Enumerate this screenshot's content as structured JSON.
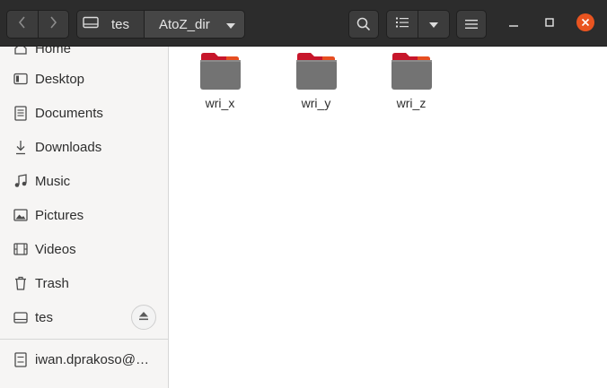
{
  "window": {
    "path": {
      "home_label": "tes",
      "current_label": "AtoZ_dir"
    }
  },
  "sidebar": {
    "items": [
      {
        "label": "Home",
        "icon": "home-icon"
      },
      {
        "label": "Desktop",
        "icon": "desktop-icon"
      },
      {
        "label": "Documents",
        "icon": "documents-icon"
      },
      {
        "label": "Downloads",
        "icon": "downloads-icon"
      },
      {
        "label": "Music",
        "icon": "music-icon"
      },
      {
        "label": "Pictures",
        "icon": "pictures-icon"
      },
      {
        "label": "Videos",
        "icon": "videos-icon"
      },
      {
        "label": "Trash",
        "icon": "trash-icon"
      },
      {
        "label": "tes",
        "icon": "drive-icon"
      },
      {
        "label": "iwan.dprakoso@…",
        "icon": "network-icon"
      }
    ]
  },
  "folders": [
    {
      "name": "wri_x"
    },
    {
      "name": "wri_y"
    },
    {
      "name": "wri_z"
    }
  ],
  "colors": {
    "headerbar": "#2c2c2c",
    "close_button": "#e95420",
    "folder_tab": "#c7162b",
    "folder_body": "#737373"
  }
}
